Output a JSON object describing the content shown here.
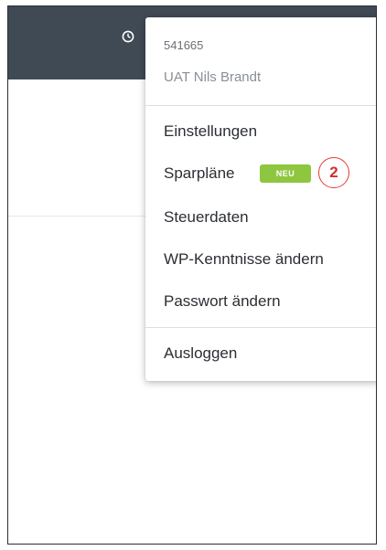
{
  "account": {
    "id": "541665",
    "name": "UAT Nils Brandt"
  },
  "menu": {
    "items": [
      {
        "label": "Einstellungen"
      },
      {
        "label": "Sparpläne",
        "badge": "NEU"
      },
      {
        "label": "Steuerdaten"
      },
      {
        "label": "WP-Kenntnisse ändern"
      },
      {
        "label": "Passwort ändern"
      },
      {
        "label": "Ausloggen"
      }
    ]
  },
  "callout": {
    "number": "2"
  },
  "colors": {
    "topbar": "#3f4a55",
    "badge": "#8ec63f",
    "callout": "#e53935"
  },
  "icons": {
    "topbar": "clock-icon"
  }
}
